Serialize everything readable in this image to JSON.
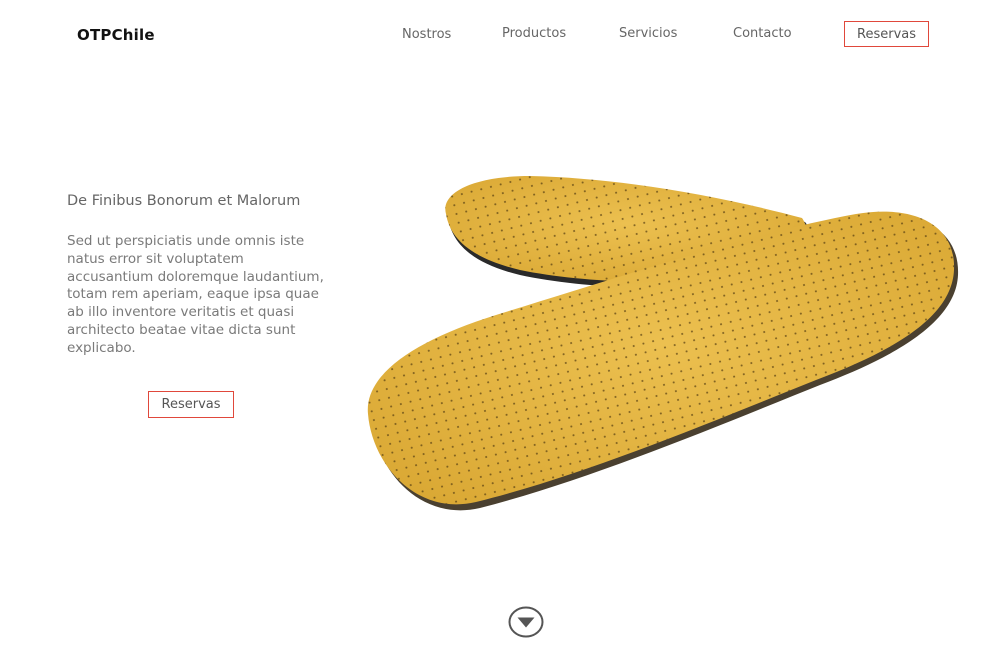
{
  "header": {
    "logo": "OTPChile",
    "nav": [
      "Nostros",
      "Productos",
      "Servicios",
      "Contacto"
    ],
    "reserve_label": "Reservas"
  },
  "hero": {
    "title": "De Finibus Bonorum et Malorum",
    "body": "Sed ut perspiciatis unde omnis iste natus error sit voluptatem accusantium doloremque laudantium, totam rem aperiam, eaque ipsa quae ab illo inventore veritatis et quasi architecto beatae vitae dicta sunt explicabo.",
    "button_label": "Reservas",
    "image": "yellow-perforated-insoles"
  },
  "scroll": {
    "icon": "chevron-down-circle-icon"
  },
  "colors": {
    "accent": "#e0483b",
    "insole": "#e6b43c",
    "text": "#666666"
  }
}
